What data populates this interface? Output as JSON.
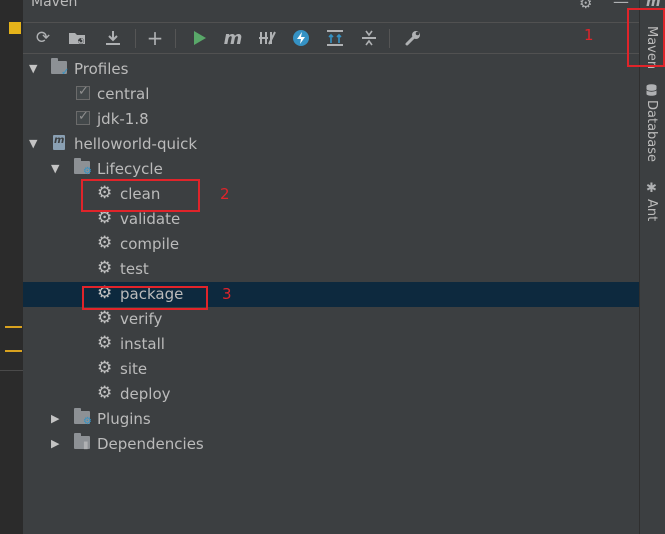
{
  "window": {
    "title": "Maven"
  },
  "toolbar": {
    "icons": [
      "reload-icon",
      "reimport-folder-icon",
      "download-icon",
      "add-icon",
      "run-icon",
      "execute-goal-icon",
      "toggle-offline-icon",
      "lightning-icon",
      "show-dependencies-icon",
      "collapse-all-icon",
      "settings-wrench-icon"
    ]
  },
  "tree": {
    "profiles": {
      "label": "Profiles",
      "items": [
        {
          "label": "central",
          "checked": true
        },
        {
          "label": "jdk-1.8",
          "checked": true
        }
      ]
    },
    "project": {
      "label": "helloworld-quick",
      "lifecycle": {
        "label": "Lifecycle",
        "goals": [
          "clean",
          "validate",
          "compile",
          "test",
          "package",
          "verify",
          "install",
          "site",
          "deploy"
        ],
        "selected": "package"
      },
      "plugins": {
        "label": "Plugins"
      },
      "dependencies": {
        "label": "Dependencies"
      }
    }
  },
  "right_sidebar": {
    "tabs": [
      {
        "label": "Maven",
        "icon": "maven-m-icon"
      },
      {
        "label": "Database",
        "icon": "database-icon"
      },
      {
        "label": "Ant",
        "icon": "ant-icon"
      }
    ]
  },
  "annotations": [
    {
      "number": "1",
      "target": "Maven",
      "color": "#e0242a"
    },
    {
      "number": "2",
      "target": "clean",
      "color": "#e0242a"
    },
    {
      "number": "3",
      "target": "package",
      "color": "#e0242a"
    }
  ],
  "colors": {
    "panel": "#3c3f41",
    "selection": "#0d293e",
    "annotation": "#e0242a",
    "run_green": "#59a869",
    "accent_blue": "#3592c4"
  }
}
